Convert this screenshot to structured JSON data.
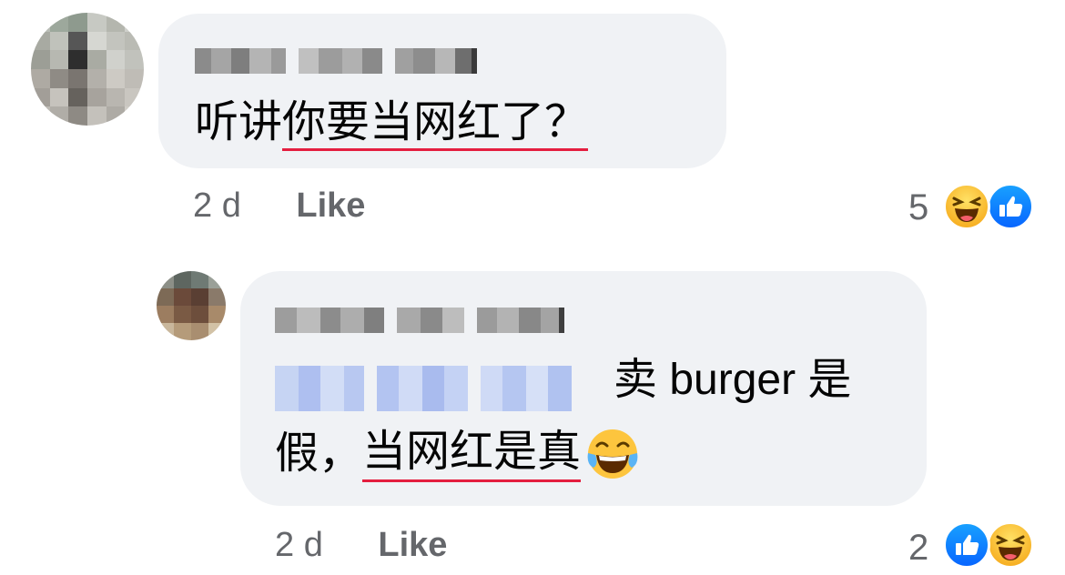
{
  "comments": [
    {
      "text_plain": "听讲",
      "text_underlined": "你要当网红了？",
      "time": "2 d",
      "like_label": "Like",
      "reaction_count": "5",
      "reactions": [
        "haha-icon",
        "like-icon"
      ]
    },
    {
      "text_mention_suffix": "卖 burger 是",
      "text_line2_plain": "假，",
      "text_line2_underlined": "当网红是真",
      "emoji": "tears-of-joy-emoji",
      "time": "2 d",
      "like_label": "Like",
      "reaction_count": "2",
      "reactions": [
        "like-icon",
        "haha-icon"
      ]
    }
  ],
  "colors": {
    "bubble": "#f0f2f5",
    "meta_text": "#65676b",
    "underline": "#e41e3f",
    "like_blue": "#0866ff",
    "haha_yellow": "#f7b125"
  }
}
